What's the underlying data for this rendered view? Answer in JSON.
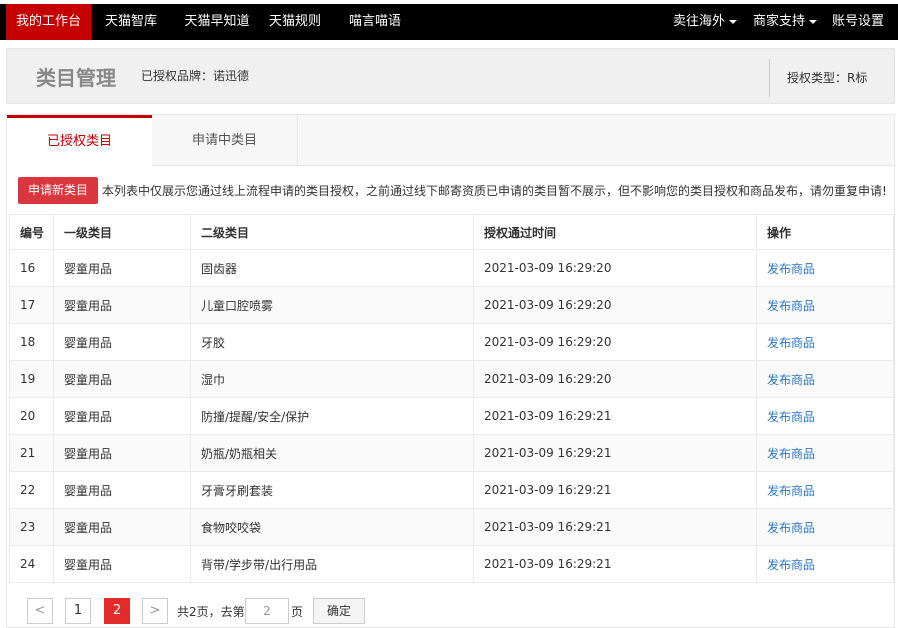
{
  "topnav": {
    "left": [
      "我的工作台",
      "天猫智库",
      "天猫早知道",
      "天猫规则",
      "喵言喵语"
    ],
    "right": [
      "卖往海外",
      "商家支持",
      "账号设置"
    ]
  },
  "header": {
    "title": "类目管理",
    "brand": "已授权品牌：诺迅德",
    "auth_type": "授权类型：R标"
  },
  "tabs": [
    "已授权类目",
    "申请中类目"
  ],
  "notice": {
    "button": "申请新类目",
    "text": "本列表中仅展示您通过线上流程申请的类目授权，之前通过线下邮寄资质已申请的类目暂不展示，但不影响您的类目授权和商品发布，请勿重复申请!"
  },
  "table": {
    "headers": [
      "编号",
      "一级类目",
      "二级类目",
      "授权通过时间",
      "操作"
    ],
    "rows": [
      [
        "16",
        "婴童用品",
        "固齿器",
        "2021-03-09 16:29:20",
        "发布商品"
      ],
      [
        "17",
        "婴童用品",
        "儿童口腔喷雾",
        "2021-03-09 16:29:20",
        "发布商品"
      ],
      [
        "18",
        "婴童用品",
        "牙胶",
        "2021-03-09 16:29:20",
        "发布商品"
      ],
      [
        "19",
        "婴童用品",
        "湿巾",
        "2021-03-09 16:29:20",
        "发布商品"
      ],
      [
        "20",
        "婴童用品",
        "防撞/提醒/安全/保护",
        "2021-03-09 16:29:21",
        "发布商品"
      ],
      [
        "21",
        "婴童用品",
        "奶瓶/奶瓶相关",
        "2021-03-09 16:29:21",
        "发布商品"
      ],
      [
        "22",
        "婴童用品",
        "牙膏牙刷套装",
        "2021-03-09 16:29:21",
        "发布商品"
      ],
      [
        "23",
        "婴童用品",
        "食物咬咬袋",
        "2021-03-09 16:29:21",
        "发布商品"
      ],
      [
        "24",
        "婴童用品",
        "背带/学步带/出行用品",
        "2021-03-09 16:29:21",
        "发布商品"
      ]
    ]
  },
  "pager": {
    "prev": "<",
    "next": ">",
    "pages": [
      "1",
      "2"
    ],
    "current": "2",
    "total_text": "共2页，去第",
    "page_unit": "页",
    "input_value": "2",
    "confirm": "确定"
  },
  "colors": {
    "accent": "#c40000",
    "link": "#2a77c9",
    "topbar": "#000000"
  }
}
